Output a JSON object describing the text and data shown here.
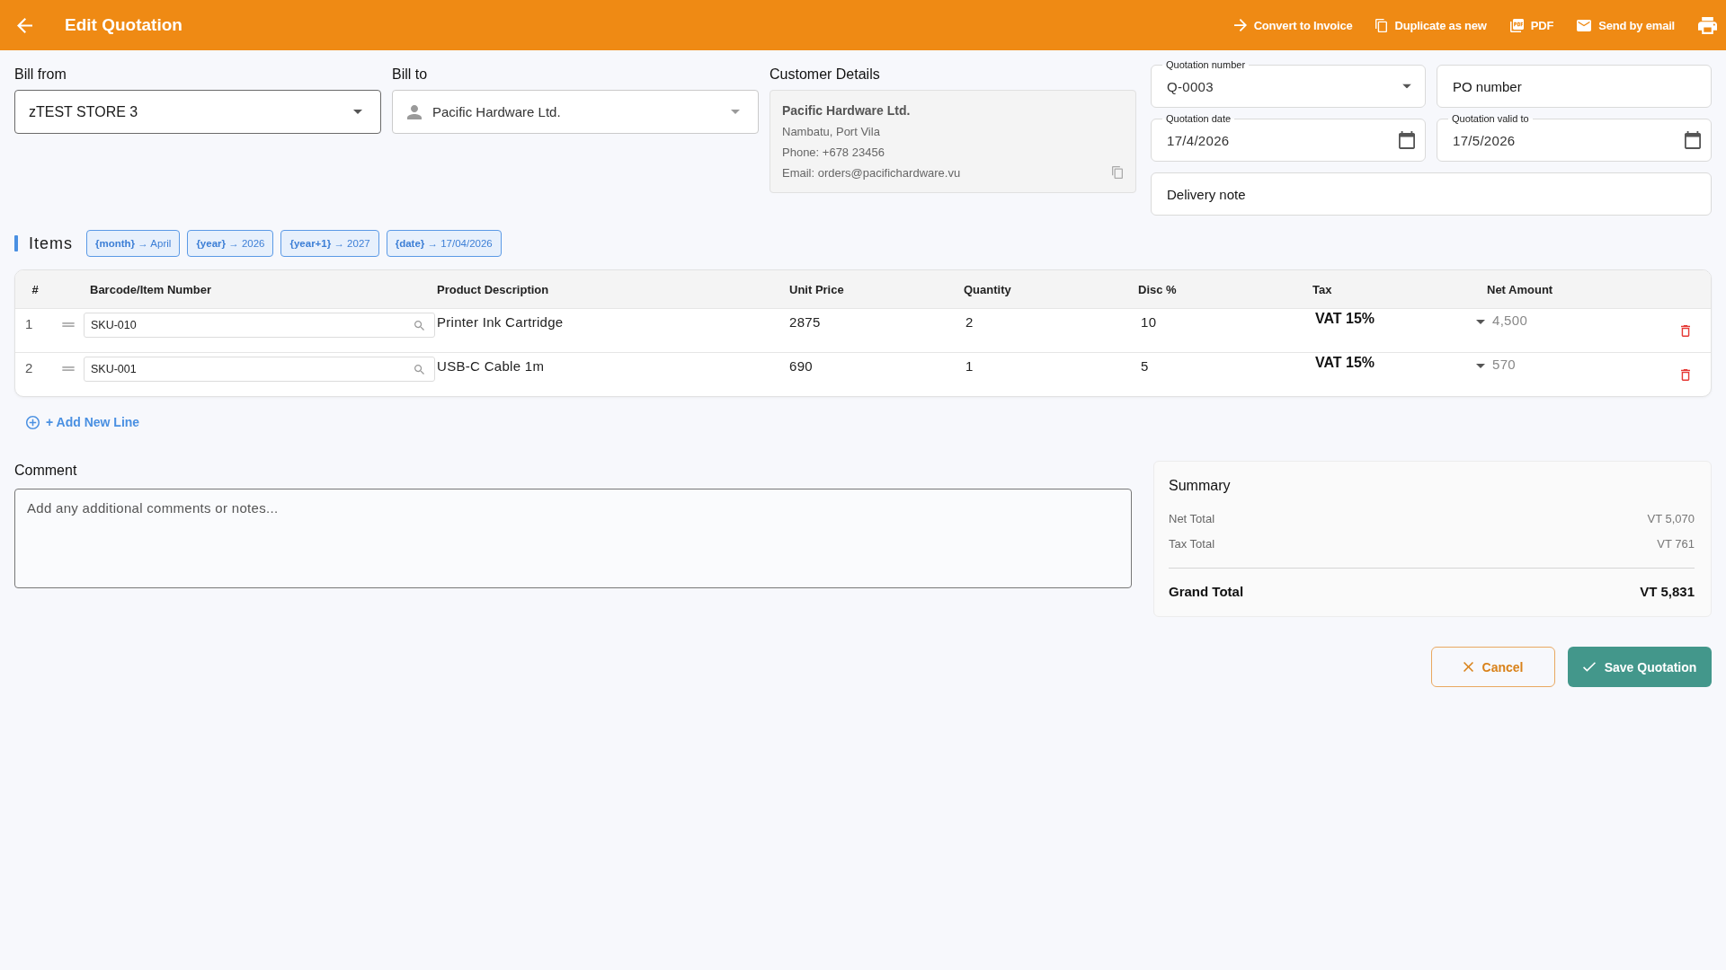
{
  "header": {
    "title": "Edit Quotation",
    "actions": [
      {
        "label": "Convert to Invoice"
      },
      {
        "label": "Duplicate as new"
      },
      {
        "label": "PDF"
      },
      {
        "label": "Send by email"
      }
    ]
  },
  "bill_from": {
    "label": "Bill from",
    "value": "zTEST STORE 3"
  },
  "bill_to": {
    "label": "Bill to",
    "value": "Pacific Hardware Ltd."
  },
  "customer_details": {
    "title": "Customer Details",
    "name": "Pacific Hardware Ltd.",
    "lines": [
      "Nambatu, Port Vila",
      "Phone: +678 23456",
      "Email: orders@pacifichardware.vu"
    ]
  },
  "fields": [
    {
      "kind": "select",
      "label": "Quotation number",
      "value": "Q-0003"
    },
    {
      "kind": "text",
      "placeholder": "PO number"
    },
    {
      "kind": "date",
      "label": "Quotation date",
      "value": "17/4/2026"
    },
    {
      "kind": "date",
      "label": "Quotation valid to",
      "value": "17/5/2026"
    }
  ],
  "delivery_note": {
    "kind": "text",
    "placeholder": "Delivery note"
  },
  "items": {
    "title": "Items",
    "variables": [
      "**{month}** → April",
      "**{year}** → 2026",
      "**{year+1}** → 2027",
      "**{date}** → 17/04/2026"
    ]
  },
  "table": {
    "columns": [
      "#",
      "Barcode/Item Number",
      "Product Description",
      "Unit Price",
      "Quantity",
      "Disc %",
      "Tax",
      "Net Amount"
    ],
    "rows": [
      {
        "number": "1",
        "barcode": "SKU-010",
        "description": "Printer Ink Cartridge",
        "unit_price": "2875",
        "quantity": "2",
        "disc": "10",
        "tax": "VAT 15%",
        "net_amount": "4,500"
      },
      {
        "number": "2",
        "barcode": "SKU-001",
        "description": "USB-C Cable 1m",
        "unit_price": "690",
        "quantity": "1",
        "disc": "5",
        "tax": "VAT 15%",
        "net_amount": "570"
      }
    ]
  },
  "add_line": {
    "label": "+ Add New Line"
  },
  "comment": {
    "label": "Comment",
    "placeholder": "Add any additional comments or notes..."
  },
  "summary": {
    "title": "Summary",
    "rows": [
      {
        "label": "Net Total",
        "value": "VT 5,070"
      },
      {
        "label": "Tax Total",
        "value": "VT 761"
      }
    ],
    "total": {
      "label": "Grand Total",
      "value": "VT 5,831"
    }
  },
  "actions": [
    {
      "kind": "cancel",
      "label": "Cancel"
    },
    {
      "kind": "save",
      "label": "Save Quotation"
    }
  ]
}
